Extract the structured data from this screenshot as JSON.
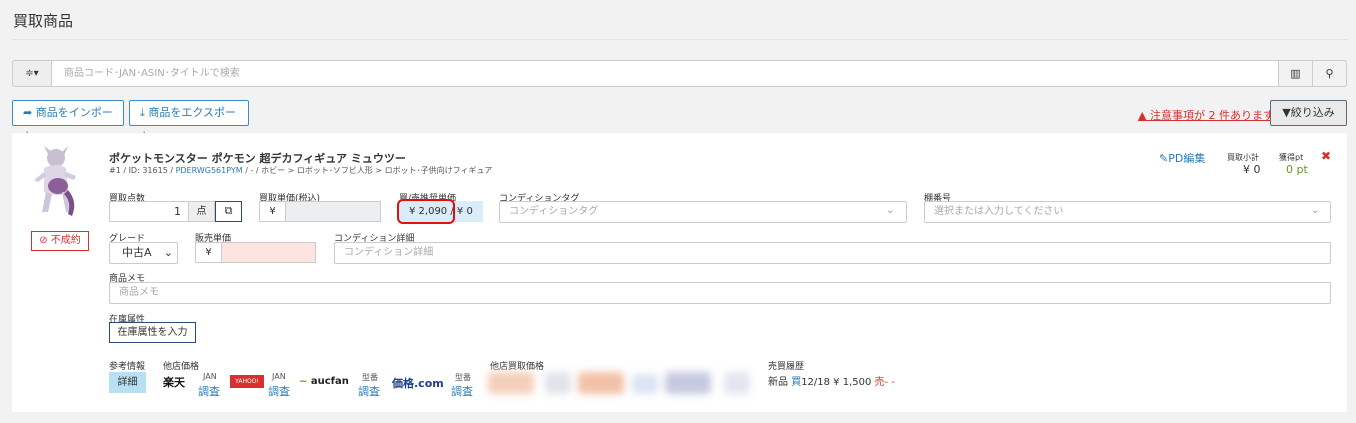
{
  "page": {
    "title": "買取商品"
  },
  "search": {
    "placeholder": "商品コード･JAN･ASIN･タイトルで検索",
    "filter_label": "≑▾"
  },
  "toolbar": {
    "import_label": "商品をインポート",
    "export_label": "商品をエクスポート",
    "warning_text": "注意事項が 2 件あります",
    "narrow_label": "絞り込み"
  },
  "item": {
    "name": "ポケットモンスター ポケモン 超デカフィギュア ミュウツー",
    "meta_prefix": "#1 / ID: 31615 / ",
    "code": "PDERWG561PYM",
    "meta_suffix": " / - / ホビー > ロボット･ソフビ人形 > ロボット･子供向けフィギュア",
    "status": "⊘ 不成約",
    "pd_edit": "PD編集",
    "subtotal_label": "買取小計",
    "subtotal_value": "¥ 0",
    "points_label": "獲得pt",
    "points_value": "0 pt",
    "qty_label": "買取点数",
    "qty_value": "1",
    "qty_unit": "点",
    "unit_price_label": "買取単価(税込)",
    "yen": "¥",
    "rec_label": "買/売推奨単価",
    "rec_buy": "¥ 2,090",
    "rec_sep": " / ",
    "rec_sell": "¥ 0",
    "cond_tag_label": "コンディションタグ",
    "cond_tag_placeholder": "コンディションタグ",
    "shelf_label": "棚番号",
    "shelf_placeholder": "選択または入力してください",
    "grade_label": "グレード",
    "grade_value": "中古A",
    "sale_label": "販売単価",
    "cond_detail_label": "コンディション詳細",
    "cond_detail_placeholder": "コンディション詳細",
    "memo_label": "商品メモ",
    "memo_placeholder": "商品メモ",
    "stock_label": "在庫属性",
    "stock_button": "在庫属性を入力",
    "ref_label": "参考情報",
    "ref_button": "詳細",
    "other_price_label": "他店価格",
    "shops": [
      {
        "logo": "楽天",
        "sub": "JAN",
        "link": "調査"
      },
      {
        "logo": "YAHOO!",
        "sub": "JAN",
        "link": "調査"
      },
      {
        "logo": "aucfan",
        "sub": "型番",
        "link": "調査"
      },
      {
        "logo": "価格.com",
        "sub": "型番",
        "link": "調査"
      }
    ],
    "other_buy_label": "他店買取価格",
    "history_label": "売買履歴",
    "history": {
      "new": "新品",
      "buy": "買",
      "date_price": "12/18 ¥ 1,500",
      "sell": "売",
      "dash": "- -"
    }
  },
  "colors": {
    "accent": "#2a7ab8",
    "danger": "#d9302f",
    "success": "#5a9a1b"
  }
}
